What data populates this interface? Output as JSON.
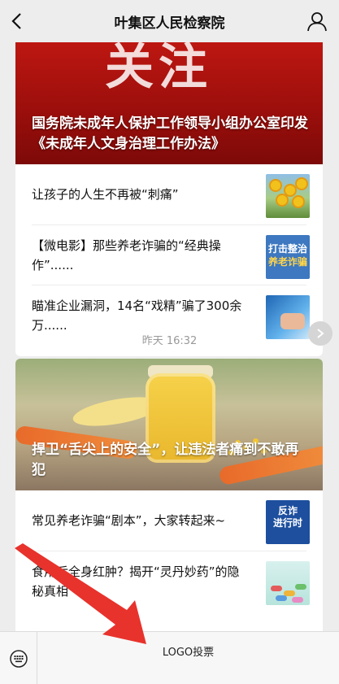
{
  "header": {
    "title": "叶集区人民检察院"
  },
  "card1": {
    "hero_big_text": "关注",
    "hero_title": "国务院未成年人保护工作领导小组办公室印发《未成年人文身治理工作办法》",
    "items": [
      {
        "text": "让孩子的人生不再被“刺痛”"
      },
      {
        "text": "【微电影】那些养老诈骗的“经典操作”......",
        "thumb_line1": "打击整治",
        "thumb_line2": "养老诈骗"
      },
      {
        "text": "瞄准企业漏洞，14名“戏精”骗了300余万......"
      }
    ]
  },
  "timestamp": "昨天 16:32",
  "card2": {
    "hero_title": "捍卫“舌尖上的安全”，让违法者痛到不敢再犯",
    "items": [
      {
        "text": "常见养老诈骗“剧本”，大家转起来~",
        "thumb_line1": "反诈",
        "thumb_line2": "进行时"
      },
      {
        "text": "食用后全身红肿？揭开“灵丹妙药”的隐秘真相"
      }
    ]
  },
  "bottom_bar": {
    "menu_label": "LOGO投票"
  },
  "colors": {
    "accent_red": "#e8322c",
    "hero_red": "#c21812"
  }
}
